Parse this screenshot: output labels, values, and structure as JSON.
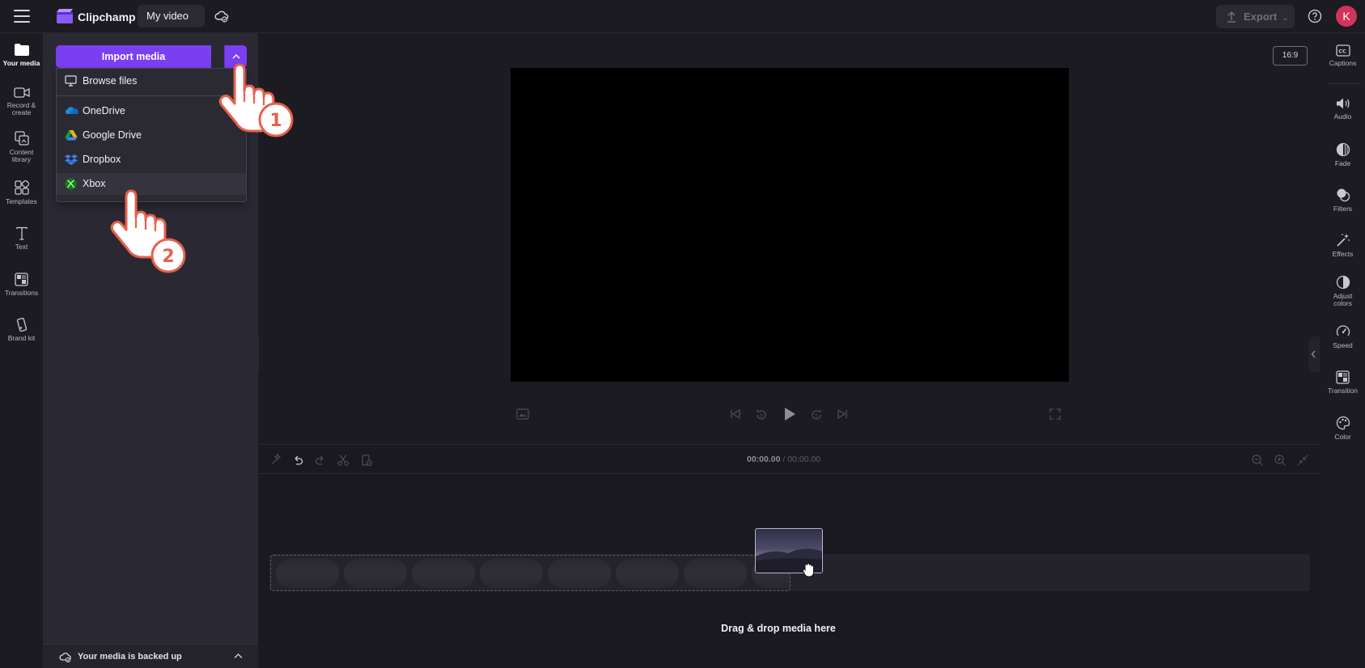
{
  "header": {
    "app_name": "Clipchamp",
    "project_title": "My video",
    "export_label": "Export",
    "avatar_initial": "K"
  },
  "left_nav": {
    "items": [
      {
        "label": "Your media",
        "icon": "folder-icon"
      },
      {
        "label": "Record & create",
        "icon": "camera-icon"
      },
      {
        "label": "Content library",
        "icon": "library-icon"
      },
      {
        "label": "Templates",
        "icon": "templates-icon"
      },
      {
        "label": "Text",
        "icon": "text-icon"
      },
      {
        "label": "Transitions",
        "icon": "transitions-icon"
      },
      {
        "label": "Brand kit",
        "icon": "brand-kit-icon"
      }
    ]
  },
  "media_panel": {
    "import_label": "Import media",
    "dropdown": {
      "browse": "Browse files",
      "sources": [
        "OneDrive",
        "Google Drive",
        "Dropbox",
        "Xbox"
      ]
    },
    "backup_status": "Your media is backed up"
  },
  "preview": {
    "aspect_ratio": "16:9"
  },
  "timeline": {
    "time_current": "00:00.00",
    "time_separator": "/",
    "time_total": "00:00.00",
    "drop_label": "Drag & drop media here"
  },
  "right_panel": {
    "items": [
      {
        "label": "Captions",
        "icon": "captions-icon"
      },
      {
        "label": "Audio",
        "icon": "speaker-icon"
      },
      {
        "label": "Fade",
        "icon": "fade-icon"
      },
      {
        "label": "Filters",
        "icon": "filters-icon"
      },
      {
        "label": "Effects",
        "icon": "magic-wand-icon"
      },
      {
        "label": "Adjust colors",
        "icon": "adjust-colors-icon"
      },
      {
        "label": "Speed",
        "icon": "speedometer-icon"
      },
      {
        "label": "Transition",
        "icon": "transition-icon"
      },
      {
        "label": "Color",
        "icon": "palette-icon"
      }
    ]
  },
  "annotations": {
    "step1": "1",
    "step2": "2"
  },
  "colors": {
    "accent": "#7b3ff2",
    "avatar": "#d1345b",
    "step_badge": "#e8604c"
  }
}
